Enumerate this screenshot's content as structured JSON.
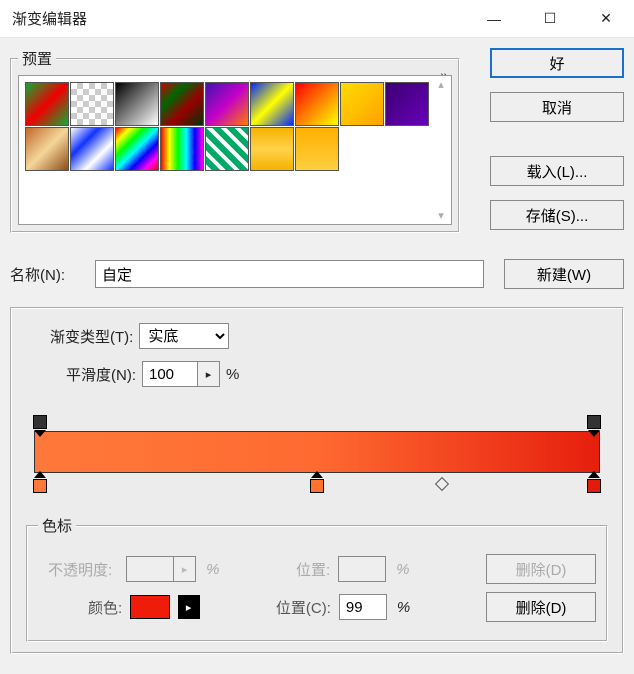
{
  "title": "渐变编辑器",
  "window_controls": {
    "min": "—",
    "max": "☐",
    "close": "✕"
  },
  "preset": {
    "legend": "预置",
    "swatches": [
      {
        "css": "linear-gradient(135deg,#1a3 0%,#e00 50%,#1a3 100%)"
      },
      {
        "css": "checker"
      },
      {
        "css": "linear-gradient(135deg,#000,#fff)"
      },
      {
        "css": "linear-gradient(135deg,#c00 0%,#060 30%,#900 60%,#030 100%)"
      },
      {
        "css": "linear-gradient(135deg,#4014ad,#c400c8,#ff7a00)"
      },
      {
        "css": "linear-gradient(135deg,#0027ff 0%,#ff0 50%,#0027ff 100%)"
      },
      {
        "css": "linear-gradient(135deg,#f00,#ff0)"
      },
      {
        "css": "linear-gradient(135deg,#ffdc00,#ffa200)"
      },
      {
        "css": "linear-gradient(135deg,#3a006e,#6a00bc)"
      },
      {
        "css": "linear-gradient(135deg,#c16a2a,#f5d59a,#8d4b17)"
      },
      {
        "css": "linear-gradient(135deg,#fff,#13f,#fff,#13f)"
      },
      {
        "css": "linear-gradient(135deg,#f00,#ff0,#0f0,#0ff,#00f,#f0f,#f00)"
      },
      {
        "css": "linear-gradient(90deg,#f00,#ff0,#0f0,#0ff,#00f,#f0f)"
      },
      {
        "css": "hash"
      },
      {
        "css": "linear-gradient(180deg,#f5b200,#ffd24a,#f5b200)"
      },
      {
        "css": "linear-gradient(180deg,#ffb000,#ffcf3e)"
      }
    ]
  },
  "buttons": {
    "ok": "好",
    "cancel": "取消",
    "load": "载入(L)...",
    "save": "存储(S)...",
    "new": "新建(W)",
    "delete": "删除(D)"
  },
  "name": {
    "label": "名称(N):",
    "value": "自定"
  },
  "grad_type": {
    "label": "渐变类型(T):",
    "value": "实底"
  },
  "smoothness": {
    "label": "平滑度(N):",
    "value": "100",
    "unit": "%"
  },
  "gradient_bar_css": "linear-gradient(90deg,#ff793a 0%,#ff6a31 50%,#e61f0e 100%)",
  "stops": {
    "opacity": [
      {
        "pos": 1,
        "color": "#333"
      },
      {
        "pos": 99,
        "color": "#333"
      }
    ],
    "color": [
      {
        "pos": 1,
        "color": "#ff793a"
      },
      {
        "pos": 50,
        "color": "#ff732f"
      },
      {
        "pos": 99,
        "color": "#e21b0c"
      }
    ],
    "midpoints": [
      72
    ]
  },
  "colorstop": {
    "legend": "色标",
    "opacity_label": "不透明度:",
    "opacity_value": "",
    "opacity_unit": "%",
    "pos_label_short": "位置:",
    "pos_value_short": "",
    "pos_unit": "%",
    "color_label": "颜色:",
    "current_color": "#f01c0a",
    "pos_label": "位置(C):",
    "pos_value": "99"
  }
}
